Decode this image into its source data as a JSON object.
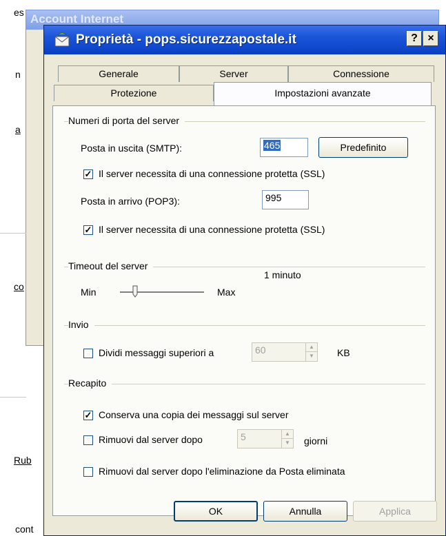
{
  "background_window": {
    "title": "Account Internet",
    "fragments": [
      "es",
      "n",
      "a",
      "co",
      "Rub",
      "cont"
    ]
  },
  "dialog": {
    "title": "Proprietà - pops.sicurezzapostale.it",
    "help_button": "?",
    "close_button": "×",
    "tabs_row1": [
      "Generale",
      "Server",
      "Connessione"
    ],
    "tabs_row2": [
      "Protezione",
      "Impostazioni avanzate"
    ],
    "active_tab": "Impostazioni avanzate"
  },
  "ports": {
    "group_label": "Numeri di porta del server",
    "smtp_label": "Posta in uscita (SMTP):",
    "smtp_value": "465",
    "default_button": "Predefinito",
    "smtp_ssl_label": "Il server necessita di una connessione protetta (SSL)",
    "smtp_ssl_checked": true,
    "pop3_label": "Posta in arrivo (POP3):",
    "pop3_value": "995",
    "pop3_ssl_label": "Il server necessita di una connessione protetta (SSL)",
    "pop3_ssl_checked": true
  },
  "timeout": {
    "group_label": "Timeout del server",
    "min_label": "Min",
    "max_label": "Max",
    "value_text": "1 minuto",
    "slider_level": 0.18
  },
  "sending": {
    "group_label": "Invio",
    "split_label": "Dividi messaggi superiori a",
    "split_checked": false,
    "split_value": "60",
    "unit": "KB"
  },
  "delivery": {
    "group_label": "Recapito",
    "keep_copy_label": "Conserva una copia dei messaggi sul server",
    "keep_copy_checked": true,
    "remove_after_label": "Rimuovi dal server dopo",
    "remove_after_checked": false,
    "remove_after_value": "5",
    "days_label": "giorni",
    "remove_deleted_label": "Rimuovi dal server dopo l'eliminazione da Posta eliminata",
    "remove_deleted_checked": false
  },
  "buttons": {
    "ok": "OK",
    "cancel": "Annulla",
    "apply": "Applica"
  }
}
